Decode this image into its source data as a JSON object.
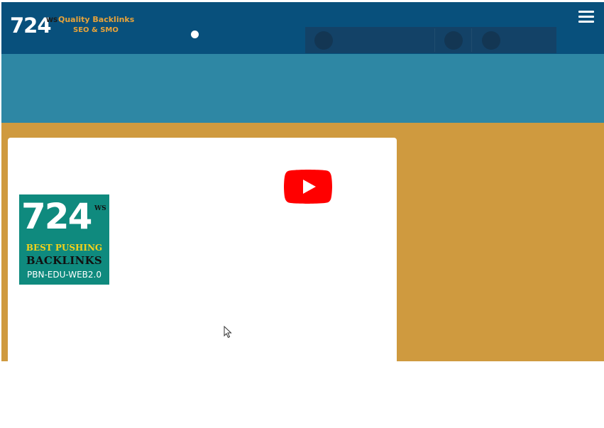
{
  "header": {
    "logo": {
      "number": "724",
      "suffix": "WS",
      "tagline_line1": "Quality Backlinks",
      "tagline_line2": "SEO & SMO"
    },
    "menu_icon": "hamburger-icon"
  },
  "video": {
    "play_icon": "youtube-play-icon",
    "thumbnail": {
      "number": "724",
      "suffix": "WS",
      "line1": "BEST PUSHING",
      "line2": "BACKLINKS",
      "line3": "PBN-EDU-WEB2.0"
    }
  },
  "colors": {
    "header": "#08507c",
    "band": "#2e87a4",
    "content_bg": "#cf9a3f",
    "logo_tagline": "#e8a33a",
    "thumbnail_bg": "#0f8a7e",
    "youtube_red": "#ff0000"
  }
}
